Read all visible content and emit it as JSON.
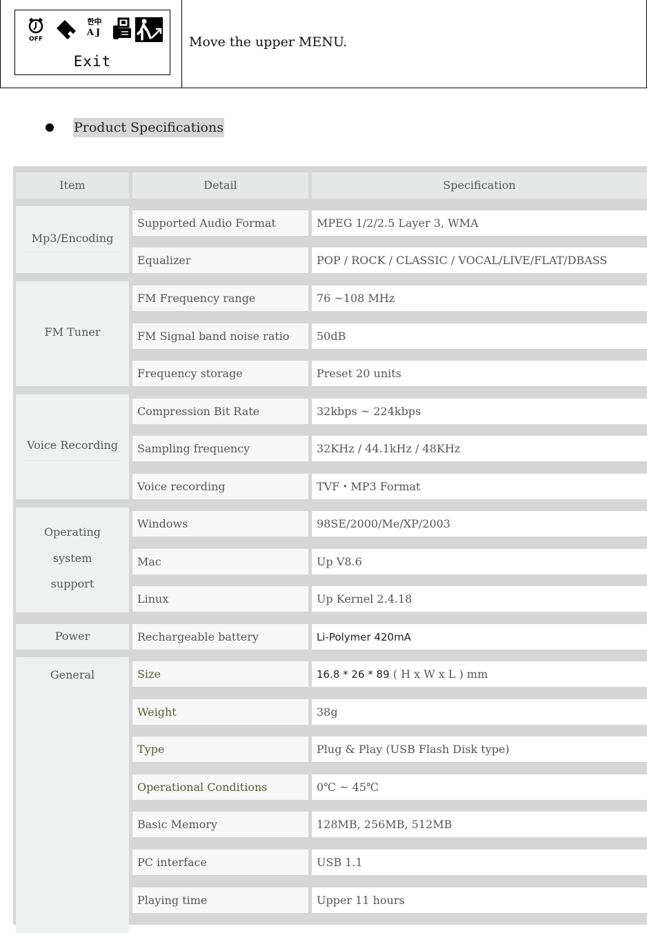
{
  "menu_row": {
    "lcd": {
      "icons": [
        "alarm-off-icon",
        "eq-diamond-icon",
        "language-icon",
        "usb-transfer-icon",
        "exit-runner-icon"
      ],
      "language_icon_top": "한中",
      "language_icon_bottom": "AJ",
      "alarm_icon_label": "OFF",
      "label": "Exit"
    },
    "description": "Move the upper MENU."
  },
  "section": {
    "title": "Product Specifications"
  },
  "spec_table": {
    "headers": {
      "item": "Item",
      "detail": "Detail",
      "specification": "Specification"
    },
    "groups": [
      {
        "item": "Mp3/Encoding",
        "rows": [
          {
            "detail": "Supported Audio Format",
            "value": "MPEG 1/2/2.5 Layer 3, WMA"
          },
          {
            "detail": "Equalizer",
            "value": "POP / ROCK / CLASSIC / VOCAL/LIVE/FLAT/DBASS"
          }
        ]
      },
      {
        "item": "FM Tuner",
        "rows": [
          {
            "detail": "FM Frequency range",
            "value": "76 ~108 MHz"
          },
          {
            "detail": "FM Signal band noise ratio",
            "value": "50dB"
          },
          {
            "detail": "Frequency storage",
            "value": "Preset 20 units"
          }
        ]
      },
      {
        "item": "Voice Recording",
        "rows": [
          {
            "detail": "Compression Bit Rate",
            "value": "32kbps ~ 224kbps"
          },
          {
            "detail": "Sampling frequency",
            "value": "32KHz / 44.1kHz / 48KHz"
          },
          {
            "detail": "Voice recording",
            "value": "TVF・MP3 Format"
          }
        ]
      },
      {
        "item_lines": [
          "Operating",
          "system",
          "support"
        ],
        "rows": [
          {
            "detail": "Windows",
            "value": "98SE/2000/Me/XP/2003"
          },
          {
            "detail": "Mac",
            "value": "Up V8.6"
          },
          {
            "detail": "Linux",
            "value": "Up Kernel 2.4.18"
          }
        ]
      },
      {
        "item": "Power",
        "rows": [
          {
            "detail": "Rechargeable battery",
            "value": "Li-Polymer 420mA"
          }
        ]
      },
      {
        "item": "General",
        "rows": [
          {
            "detail": "Size",
            "value_prefix": "16.8 * 26 * 89",
            "value_suffix": " ( H x W x L ) mm"
          },
          {
            "detail": "Weight",
            "value": "38g"
          },
          {
            "detail": "Type",
            "value": "Plug & Play (USB Flash Disk type)"
          },
          {
            "detail": "Operational Conditions",
            "value": "0℃ ~ 45℃"
          },
          {
            "detail": "Basic Memory",
            "value": "128MB, 256MB, 512MB"
          },
          {
            "detail": "PC interface",
            "value": "USB 1.1"
          },
          {
            "detail": "Playing time",
            "value": "Upper 11 hours"
          }
        ]
      }
    ]
  }
}
